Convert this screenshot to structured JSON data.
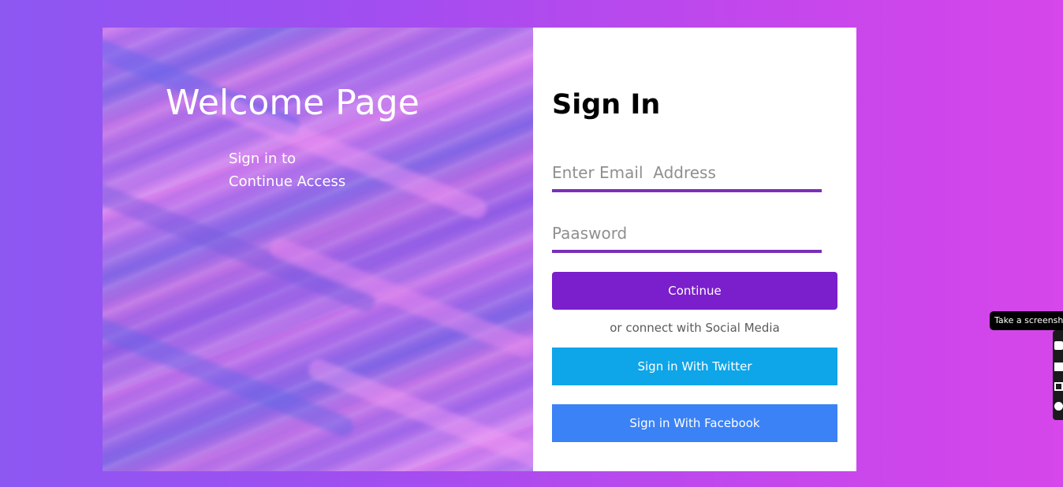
{
  "welcome": {
    "title": "Welcome Page",
    "subtitle_line1": "Sign in to",
    "subtitle_line2": "Continue Access"
  },
  "signin": {
    "title": "Sign In",
    "email_placeholder": "Enter Email  Address",
    "password_placeholder": "Paasword",
    "continue_label": "Continue",
    "social_note": "or connect with Social Media",
    "twitter_label": "Sign in With Twitter",
    "facebook_label": "Sign in With Facebook"
  },
  "screenshot_widget": {
    "tooltip": "Take a screenshot",
    "icons": [
      "camera-icon",
      "fullscreen-icon",
      "window-icon",
      "gear-icon"
    ]
  },
  "colors": {
    "page_gradient_start": "#8d57f2",
    "page_gradient_end": "#d646ea",
    "continue_button": "#7b1fcc",
    "twitter_button": "#0ea5e9",
    "facebook_button": "#3b82f6",
    "input_underline": "#7a2fb8"
  }
}
